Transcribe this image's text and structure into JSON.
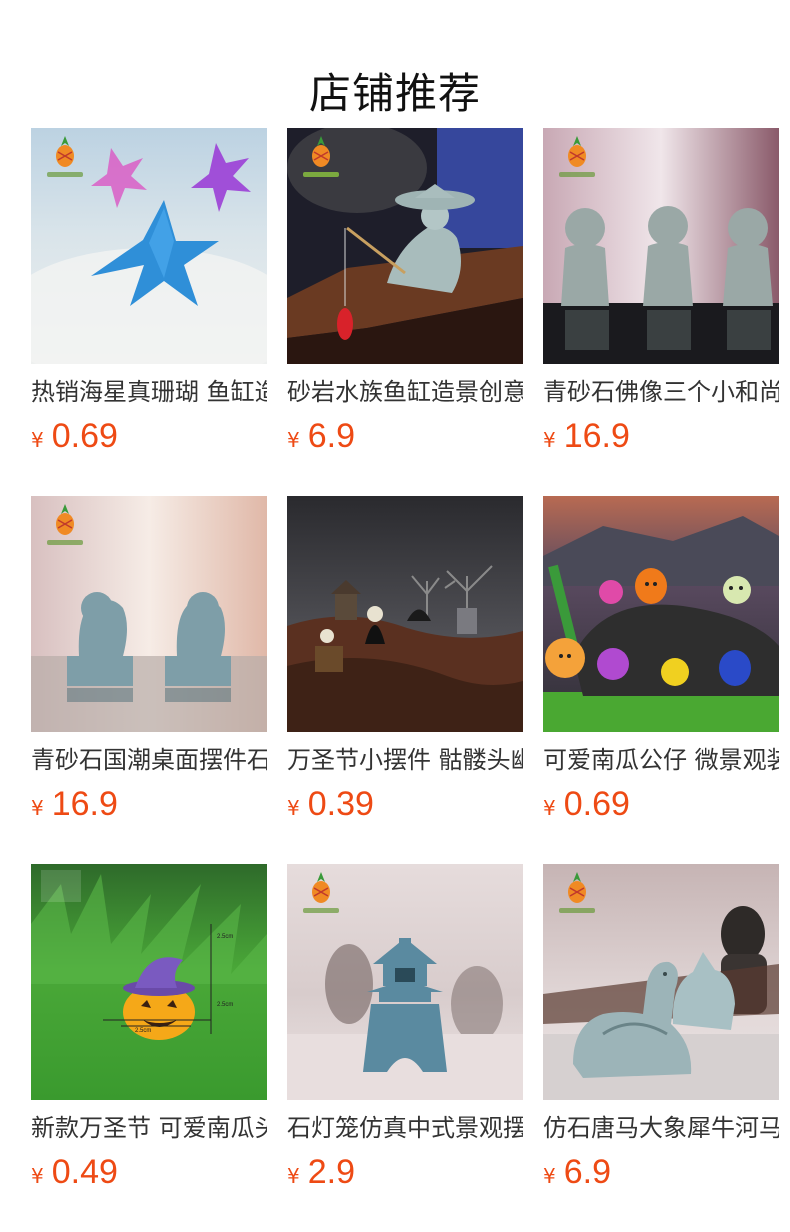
{
  "header": {
    "title": "店铺推荐"
  },
  "currency_symbol": "¥",
  "products": [
    {
      "name": "热销海星真珊瑚 鱼缸造景装饰",
      "price": "0.69",
      "image": "blue-starfish-on-sand"
    },
    {
      "name": "砂岩水族鱼缸造景创意摆件",
      "price": "6.9",
      "image": "stone-fisherman-figurine"
    },
    {
      "name": "青砂石佛像三个小和尚摆件",
      "price": "16.9",
      "image": "three-little-monks"
    },
    {
      "name": "青砂石国潮桌面摆件石狮子",
      "price": "16.9",
      "image": "stone-lion-pair"
    },
    {
      "name": "万圣节小摆件 骷髅头幽灵",
      "price": "0.39",
      "image": "halloween-skeleton-scene"
    },
    {
      "name": "可爱南瓜公仔 微景观装饰",
      "price": "0.69",
      "image": "cute-pumpkin-figures"
    },
    {
      "name": "新款万圣节 可爱南瓜头摆件",
      "price": "0.49",
      "image": "pumpkin-with-wizard-hat"
    },
    {
      "name": "石灯笼仿真中式景观摆件",
      "price": "2.9",
      "image": "stone-lantern-pagoda"
    },
    {
      "name": "仿石唐马大象犀牛河马摆件",
      "price": "6.9",
      "image": "stone-horse-and-rhino"
    }
  ],
  "image_annotations": {
    "pumpkin_dimensions": [
      "2.5cm",
      "2.5cm",
      "2.5cm"
    ]
  }
}
